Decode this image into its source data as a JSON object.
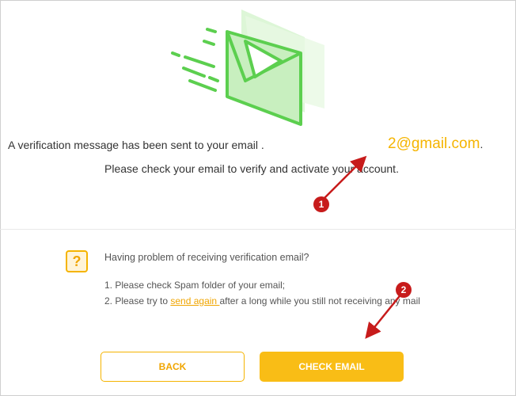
{
  "verification": {
    "message_prefix": "A verification message has been sent to your email .",
    "email_domain": "2@gmail.com",
    "email_end": ".",
    "message_line2": "Please check your email to verify and activate your account."
  },
  "help": {
    "icon_glyph": "?",
    "title": "Having problem of receiving verification email?",
    "tip1": "1. Please check Spam folder of your email;",
    "tip2_prefix": "2. Please try to ",
    "tip2_link": "send again ",
    "tip2_suffix": "after a long while you still not receiving any mail"
  },
  "buttons": {
    "back": "BACK",
    "check_email": "CHECK EMAIL"
  },
  "annotations": {
    "badge1": "1",
    "badge2": "2"
  },
  "colors": {
    "accent": "#f5b400",
    "button_fill": "#f9bd16",
    "illustration_green": "#5ccf4f",
    "annotation_red": "#c71b1b"
  },
  "icons": [
    "envelope-illustration",
    "question-icon",
    "arrow-annotation"
  ]
}
